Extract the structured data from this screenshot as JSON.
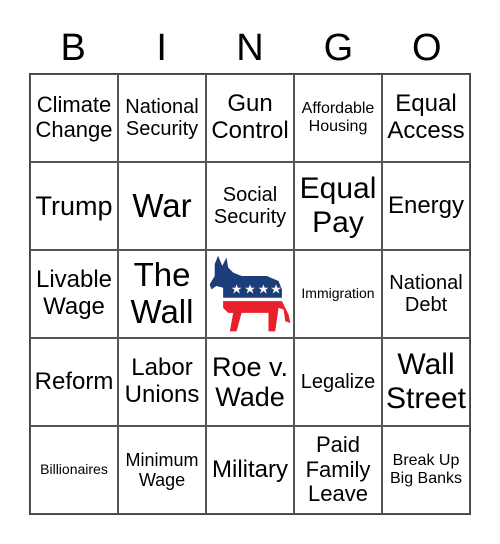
{
  "header": [
    "B",
    "I",
    "N",
    "G",
    "O"
  ],
  "cells": [
    {
      "text": "Climate Change",
      "size": "s22"
    },
    {
      "text": "National Security",
      "size": "s20"
    },
    {
      "text": "Gun Control",
      "size": "s24"
    },
    {
      "text": "Affordable Housing",
      "size": "s16"
    },
    {
      "text": "Equal Access",
      "size": "s24"
    },
    {
      "text": "Trump",
      "size": "s27"
    },
    {
      "text": "War",
      "size": "s33"
    },
    {
      "text": "Social Security",
      "size": "s20"
    },
    {
      "text": "Equal Pay",
      "size": "s30"
    },
    {
      "text": "Energy",
      "size": "s24"
    },
    {
      "text": "Livable Wage",
      "size": "s24"
    },
    {
      "text": "The Wall",
      "size": "s33"
    },
    {
      "text": "",
      "size": "s14",
      "icon": "democrat-donkey-icon"
    },
    {
      "text": "Immigration",
      "size": "s14"
    },
    {
      "text": "National Debt",
      "size": "s20"
    },
    {
      "text": "Reform",
      "size": "s24"
    },
    {
      "text": "Labor Unions",
      "size": "s24"
    },
    {
      "text": "Roe v. Wade",
      "size": "s27"
    },
    {
      "text": "Legalize",
      "size": "s20"
    },
    {
      "text": "Wall Street",
      "size": "s30"
    },
    {
      "text": "Billionaires",
      "size": "s14"
    },
    {
      "text": "Minimum Wage",
      "size": "s18"
    },
    {
      "text": "Military",
      "size": "s24"
    },
    {
      "text": "Paid Family Leave",
      "size": "s22"
    },
    {
      "text": "Break Up Big Banks",
      "size": "s16"
    }
  ],
  "colors": {
    "donkey_blue": "#1c3d7a",
    "donkey_red": "#e8202a"
  }
}
